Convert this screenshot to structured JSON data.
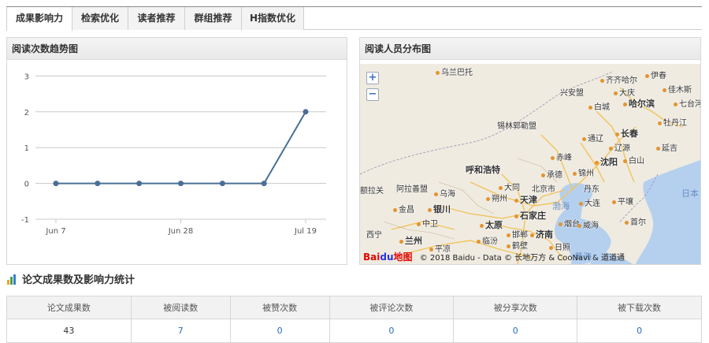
{
  "tabs": [
    {
      "label": "成果影响力",
      "active": true
    },
    {
      "label": "检索优化",
      "active": false
    },
    {
      "label": "读者推荐",
      "active": false
    },
    {
      "label": "群组推荐",
      "active": false
    },
    {
      "label": "H指数优化",
      "active": false
    }
  ],
  "trend_panel": {
    "title": "阅读次数趋势图"
  },
  "map_panel": {
    "title": "阅读人员分布图",
    "zoom_in": "+",
    "zoom_out": "−",
    "logo_bai": "Bai",
    "logo_du": "du",
    "logo_map": "地图",
    "attribution": "© 2018 Baidu - Data © 长地万方 & CooNavi & 道道通",
    "places": {
      "wulanbatuo": "乌兰巴托",
      "yichun": "伊春",
      "qiqihaer": "齐齐哈尔",
      "daqing": "大庆",
      "jiamusi": "佳木斯",
      "haerbin": "哈尔滨",
      "xinganmeng": "兴安盟",
      "baicheng": "白城",
      "qitaihe": "七台河",
      "mudanjiang": "牡丹江",
      "xilinguole": "锡林郭勒盟",
      "tongliao": "通辽",
      "changchun": "长春",
      "liaoyuan": "辽源",
      "yanji": "延吉",
      "chifeng": "赤峰",
      "huhehaote": "呼和浩特",
      "chengde": "承德",
      "jinzhou": "锦州",
      "shenyang": "沈阳",
      "baishan": "白山",
      "alashan": "阿拉善盟",
      "datong": "大同",
      "beijing": "北京市",
      "dandong": "丹东",
      "wuhai": "乌海",
      "tianjin": "天津",
      "yinchuan": "银川",
      "shuozhou": "朔州",
      "dalian": "大连",
      "pyongyang": "平壤",
      "jinchang": "金昌",
      "zhongwei": "中卫",
      "taiyuan": "太原",
      "shijiazhuang": "石家庄",
      "yantai": "烟台",
      "weihai": "威海",
      "seoul": "首尔",
      "xining": "西宁",
      "lanzhou": "兰州",
      "linfen": "临汾",
      "handan": "邯郸",
      "jinan": "济南",
      "pingliang": "平凉",
      "hebi": "鹤壁",
      "rizhao": "日照",
      "zhengzhou": "郑州",
      "xian": "西安",
      "elaguan": "额拉关",
      "bohai": "渤海",
      "huanghai": "黄海",
      "japan": "日本"
    }
  },
  "chart_data": {
    "type": "line",
    "x_labels": [
      "Jun 7",
      "Jun 28",
      "Jul 19"
    ],
    "x_label_indices": [
      0,
      3,
      6
    ],
    "values": [
      0,
      0,
      0,
      0,
      0,
      0,
      2
    ],
    "ylim": [
      -1,
      3
    ],
    "yticks": [
      -1,
      0,
      1,
      2,
      3
    ],
    "grid": true,
    "color": "#4a6f96"
  },
  "stats": {
    "title": "论文成果数及影响力统计",
    "headers": [
      "论文成果数",
      "被阅读数",
      "被赞次数",
      "被评论次数",
      "被分享次数",
      "被下载次数"
    ],
    "values": [
      "43",
      "7",
      "0",
      "0",
      "0",
      "0"
    ]
  }
}
